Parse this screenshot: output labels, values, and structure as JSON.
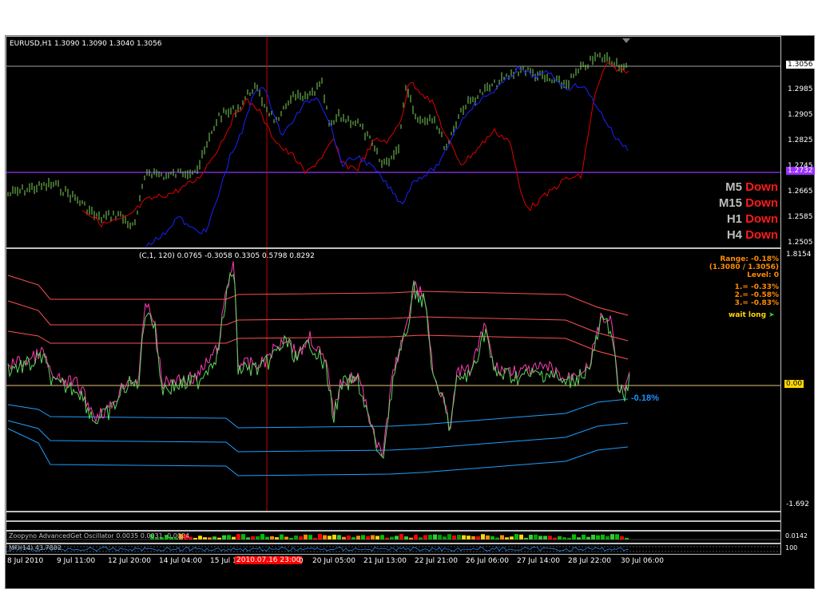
{
  "main_chart": {
    "title": "EURUSD,H1  1.3090 1.3090 1.3040 1.3056",
    "price_levels": [
      "1.3056",
      "1.2985",
      "1.2905",
      "1.2825",
      "1.2745",
      "1.2665",
      "1.2585",
      "1.2505"
    ],
    "current_price_tag": "1.3056",
    "line_price_tag": "1.2732",
    "timeframes": [
      {
        "tf": "M5",
        "signal": "Down"
      },
      {
        "tf": "M15",
        "signal": "Down"
      },
      {
        "tf": "H1",
        "signal": "Down"
      },
      {
        "tf": "H4",
        "signal": "Down"
      }
    ]
  },
  "indicator": {
    "title": "(C,1, 120)  0.0765 -0.3058 0.3305 0.5798 0.8292",
    "range": "Range: -0.18%",
    "range_sub": "(1.3080 / 1.3056)",
    "level": "Level: 0",
    "levels": [
      "1.= -0.33%",
      "2.= -0.58%",
      "3.= -0.83%"
    ],
    "status": "wait long",
    "value_label": "-0.18%",
    "scale_top": "1.8154",
    "scale_bottom": "-1.692",
    "zero_tag": "0.00"
  },
  "sub_windows": {
    "oscillator_title": "Zoopyno AdvancedGet Oscillator 0.0035 0.0031 -0.0024",
    "oscillator_scale": "0.0142",
    "mfi_title": "MFI(14) 43.7802",
    "mfi_scale": "100"
  },
  "time_axis": {
    "labels": [
      "8 Jul 2010",
      "9 Jul 11:00",
      "12 Jul 20:00",
      "14 Jul 04:00",
      "15 Jul 1",
      "21 Jul 13:00",
      "22 Jul 21:00",
      "26 Jul 06:00",
      "27 Jul 14:00",
      "28 Jul 22:00",
      "30 Jul 06:00"
    ],
    "cursor_label": "2010.07.16 23:00",
    "after_cursor": "0",
    "mid_label": "20 Jul 05:00"
  }
}
